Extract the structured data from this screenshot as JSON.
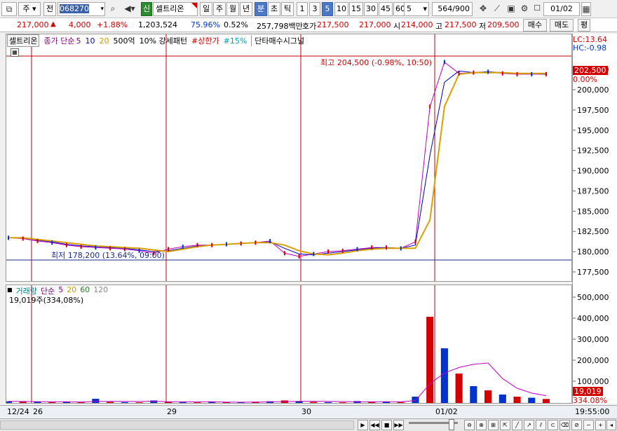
{
  "toolbar": {
    "type_btn": "주",
    "prev_btn": "전",
    "code": "068270",
    "badge": "신",
    "name": "셀트리온",
    "periods": [
      "일",
      "주",
      "월",
      "년",
      "분",
      "초",
      "틱"
    ],
    "minutes": [
      "1",
      "3",
      "5",
      "10",
      "15",
      "30",
      "45",
      "60"
    ],
    "selected_period": "분",
    "selected_min": "5",
    "combo_val": "5",
    "count": "564/900",
    "date": "01/02"
  },
  "quote": {
    "price": "217,000",
    "change": "4,000",
    "rate": "+1.88%",
    "volume": "1,203,524",
    "ratio": "75.96%",
    "turnover": "0.52%",
    "amount": "257,798백만",
    "hoga_label": "호가",
    "hoga_ask": "217,500",
    "hoga_bid": "217,000",
    "open_label": "시",
    "open": "214,000",
    "high_label": "고",
    "high": "217,500",
    "low_label": "저",
    "low": "209,500",
    "buy_btn": "매수",
    "sell_btn": "매도",
    "eval_btn": "평"
  },
  "legend": {
    "name": "셀트리온",
    "close_label": "종가 단순",
    "ma": [
      "5",
      "10",
      "20"
    ],
    "amt": "500억",
    "pattern": "10% 강세패턴",
    "limit": "#상한가",
    "pct": "#15%",
    "signal": "단타매수시그널"
  },
  "annot": {
    "high": "최고 204,500 (-0.98%, 10:50)",
    "low": "최저 178,200 (13.64%, 09:00)",
    "lc": "LC:13.64",
    "hc": "HC:-0.98",
    "cur_price": "202,500",
    "zero_pct": "0.00%"
  },
  "vol_legend": {
    "label": "거래량",
    "ma_label": "단순",
    "ma": [
      "5",
      "20",
      "60",
      "120"
    ],
    "info": "19,019주(334,08%)"
  },
  "vol_tags": {
    "val": "19,019",
    "pct": "334.08%"
  },
  "xaxis": {
    "labels": [
      "12/24",
      "26",
      "29",
      "30",
      "01/02"
    ],
    "time": "19:55:00"
  },
  "colors": {
    "accent": "#4a78c4",
    "up": "#d40000",
    "down": "#0033cc"
  },
  "chart_data": [
    {
      "type": "line",
      "title": "셀트리온",
      "ylim": [
        177500,
        202500
      ],
      "yticks": [
        177500,
        180000,
        182500,
        185000,
        187500,
        190000,
        192500,
        195000,
        197500,
        200000,
        202500
      ],
      "series": [
        {
          "name": "5",
          "values": [
            181800,
            181700,
            181400,
            181200,
            180900,
            180700,
            180600,
            180500,
            180400,
            180200,
            179900,
            180400,
            180700,
            180900,
            180900,
            181000,
            181100,
            181200,
            181400,
            179900,
            179500,
            179800,
            180100,
            180200,
            180400,
            180600,
            180600,
            180500,
            181300,
            198000,
            203500,
            202100,
            202200,
            202300,
            202100,
            202000,
            202000,
            202000
          ]
        },
        {
          "name": "10",
          "values": [
            181800,
            181800,
            181500,
            181300,
            181000,
            180800,
            180700,
            180600,
            180500,
            180300,
            180100,
            180200,
            180500,
            180800,
            180900,
            181000,
            181100,
            181200,
            181300,
            180500,
            179800,
            179700,
            179900,
            180100,
            180300,
            180500,
            180600,
            180500,
            180900,
            192000,
            201000,
            202400,
            202200,
            202300,
            202200,
            202100,
            202100,
            202000
          ]
        },
        {
          "name": "20",
          "values": [
            181800,
            181800,
            181600,
            181400,
            181200,
            181000,
            180800,
            180700,
            180600,
            180500,
            180300,
            180100,
            180400,
            180700,
            180900,
            181000,
            181100,
            181200,
            181200,
            180900,
            180200,
            179800,
            179700,
            179900,
            180200,
            180400,
            180500,
            180500,
            180500,
            184000,
            198000,
            202000,
            202200,
            202200,
            202200,
            202100,
            202100,
            202100
          ]
        }
      ]
    },
    {
      "type": "bar",
      "title": "거래량",
      "ylim": [
        0,
        500000
      ],
      "yticks": [
        100000,
        200000,
        300000,
        400000,
        500000
      ],
      "series": [
        {
          "name": "거래량",
          "values": [
            8000,
            6000,
            5000,
            4000,
            6000,
            3000,
            20000,
            5000,
            4000,
            3000,
            12000,
            6000,
            4000,
            3000,
            5000,
            4000,
            3000,
            6000,
            8000,
            12000,
            9000,
            5000,
            4000,
            3000,
            9000,
            6000,
            7000,
            4000,
            30000,
            410000,
            260000,
            140000,
            80000,
            60000,
            40000,
            30000,
            25000,
            19019
          ]
        }
      ]
    }
  ]
}
